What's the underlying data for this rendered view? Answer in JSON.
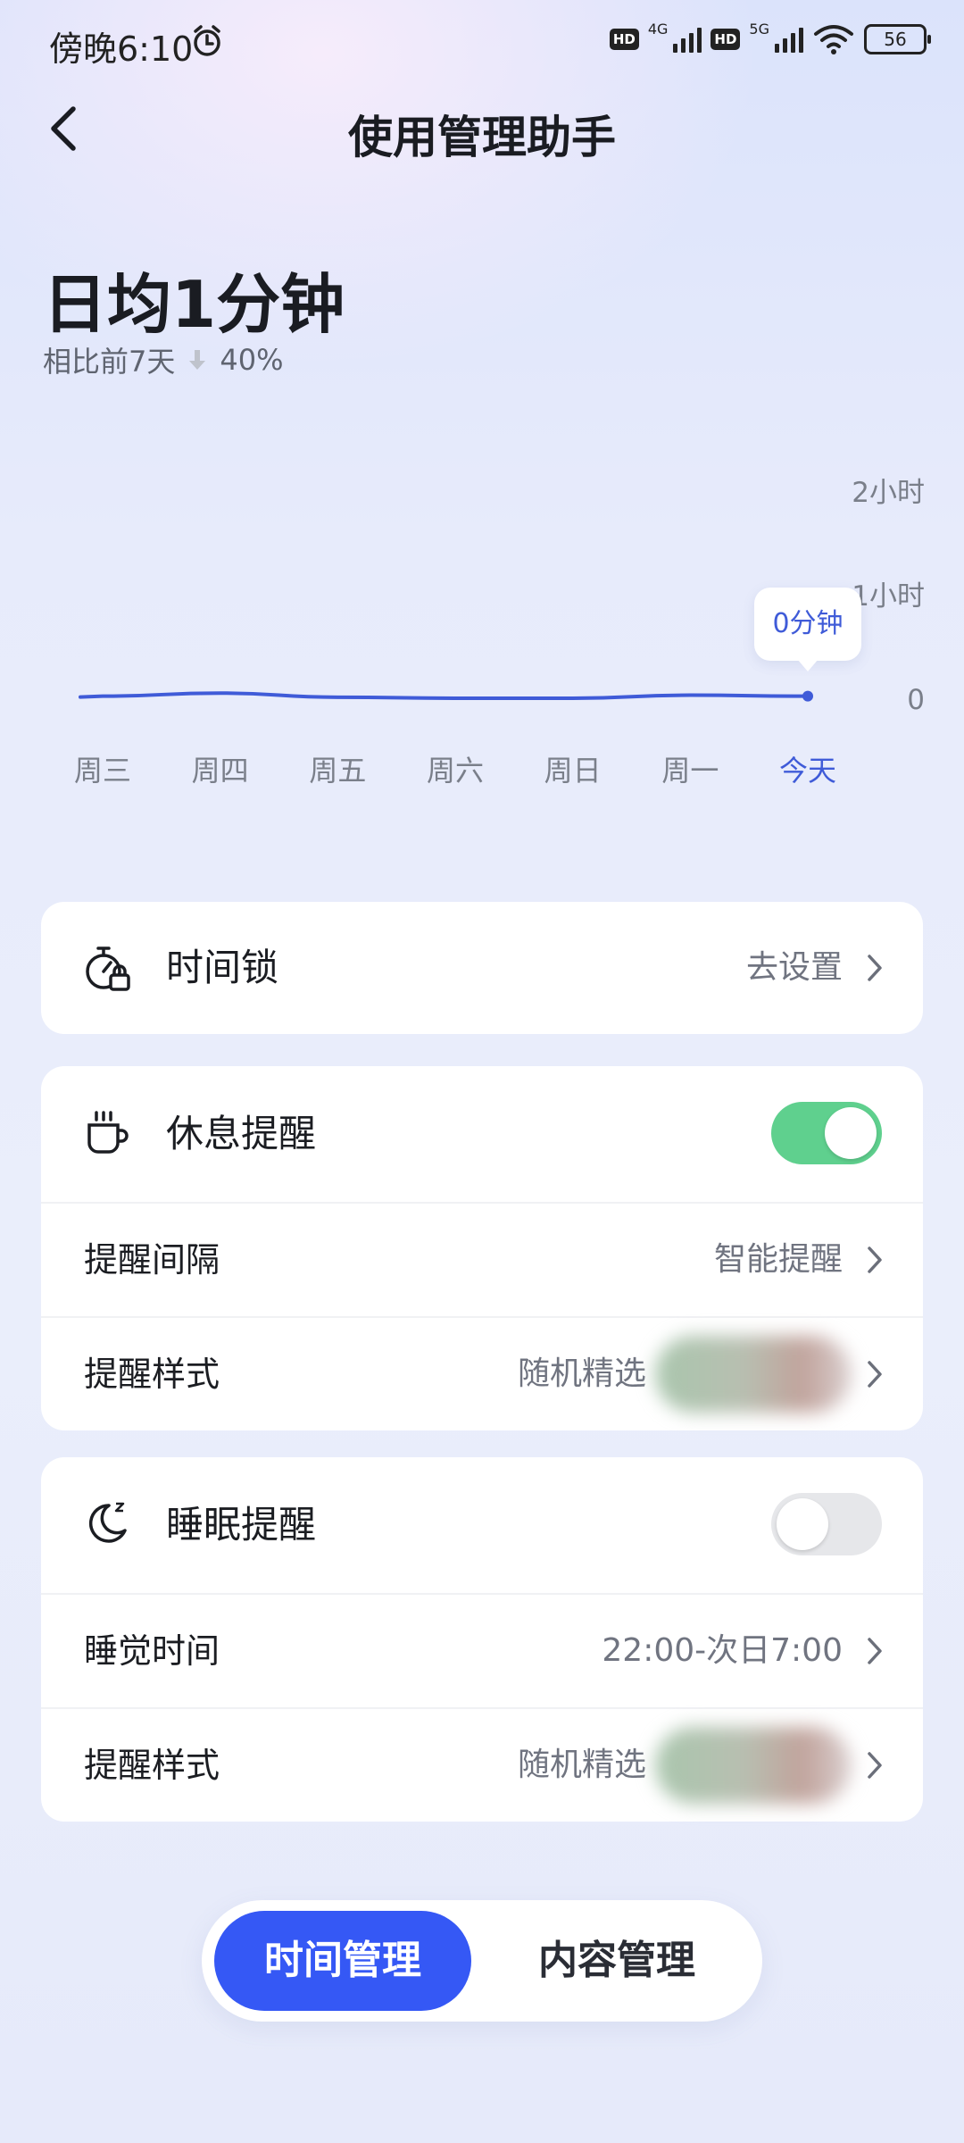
{
  "status_bar": {
    "time": "傍晚6:10",
    "network_1": "4G",
    "network_2": "5G",
    "hd_label": "HD",
    "battery": "56"
  },
  "header": {
    "title": "使用管理助手"
  },
  "summary": {
    "daily_average": "日均1分钟",
    "compare_label": "相比前7天",
    "compare_value": "40%"
  },
  "chart_data": {
    "type": "line",
    "categories": [
      "周三",
      "周四",
      "周五",
      "周六",
      "周日",
      "周一",
      "今天"
    ],
    "values": [
      0.02,
      0.05,
      0.01,
      0.0,
      0.0,
      0.03,
      0.02
    ],
    "y_ticks": [
      "2小时",
      "1小时",
      "0"
    ],
    "ylim": [
      0,
      2
    ],
    "tooltip": "0分钟",
    "highlight_index": 6,
    "line_color": "#3f5bd8",
    "highlight_color": "#3f5bd8",
    "axis_color": "#7a7f8a"
  },
  "time_lock": {
    "label": "时间锁",
    "action": "去设置"
  },
  "rest_reminder": {
    "label": "休息提醒",
    "enabled": true,
    "interval_label": "提醒间隔",
    "interval_value": "智能提醒",
    "style_label": "提醒样式",
    "style_value": "随机精选"
  },
  "sleep_reminder": {
    "label": "睡眠提醒",
    "enabled": false,
    "time_label": "睡觉时间",
    "time_value": "22:00-次日7:00",
    "style_label": "提醒样式",
    "style_value": "随机精选"
  },
  "bottom_tabs": {
    "active": "时间管理",
    "inactive": "内容管理"
  },
  "colors": {
    "accent": "#3558f5",
    "toggle_on": "#5fd08e",
    "toggle_off": "#e6e7ea"
  }
}
